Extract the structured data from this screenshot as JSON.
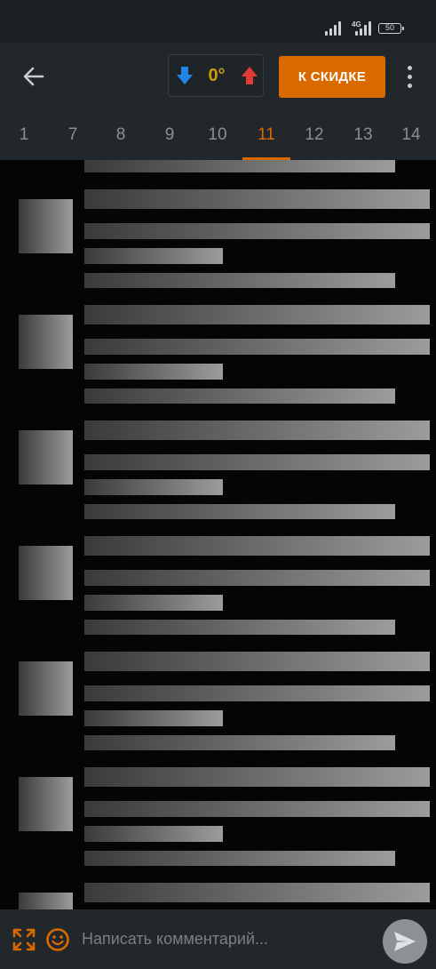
{
  "status_bar": {
    "network_label": "4G",
    "battery_level": "50"
  },
  "toolbar": {
    "back_icon": "arrow-left-icon",
    "rating": {
      "value": "0°",
      "down_icon": "arrow-down-icon",
      "up_icon": "arrow-up-icon",
      "down_color": "#1e88e5",
      "up_color": "#e53935",
      "value_color": "#cf9a0e"
    },
    "discount_button": "К СКИДКЕ",
    "more_icon": "more-vertical-icon",
    "accent_color": "#d96a00"
  },
  "tabs": [
    {
      "label": "1"
    },
    {
      "label": "7"
    },
    {
      "label": "8"
    },
    {
      "label": "9"
    },
    {
      "label": "10"
    },
    {
      "label": "11",
      "active": true
    },
    {
      "label": "12"
    },
    {
      "label": "13"
    },
    {
      "label": "14"
    }
  ],
  "feed": {
    "state": "loading-skeleton",
    "placeholder_count": 7
  },
  "comment_bar": {
    "placeholder": "Написать комментарий...",
    "expand_icon": "expand-icon",
    "emoji_icon": "emoji-icon",
    "send_icon": "send-icon"
  }
}
